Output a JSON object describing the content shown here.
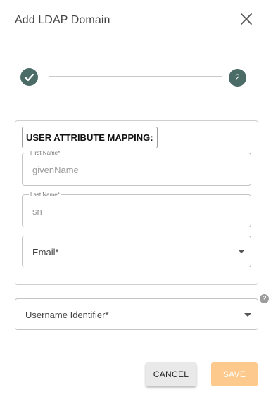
{
  "dialog": {
    "title": "Add LDAP Domain",
    "close_icon": "close-icon"
  },
  "stepper": {
    "step1_icon": "check-icon",
    "step2_number": "2",
    "active_color": "#4b6b66"
  },
  "mapping": {
    "label": "USER ATTRIBUTE MAPPING:",
    "first_name": {
      "label": "First Name*",
      "value": "givenName"
    },
    "last_name": {
      "label": "Last Name*",
      "value": "sn"
    },
    "email": {
      "label": "Email*",
      "icon": "chevron-down-icon"
    }
  },
  "username_identifier": {
    "label": "Username Identifier*",
    "icon": "chevron-down-icon",
    "help_icon": "help-icon",
    "help_glyph": "?"
  },
  "actions": {
    "cancel_label": "CANCEL",
    "save_label": "SAVE",
    "save_color": "#fdc98c"
  }
}
